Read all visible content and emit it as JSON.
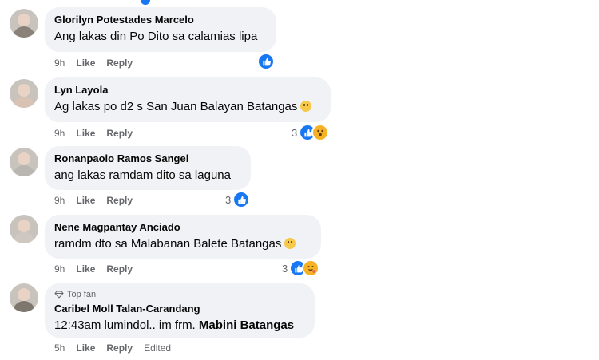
{
  "comments": [
    {
      "name": "Glorilyn Potestades Marcelo",
      "text": "Ang lakas din Po Dito sa calamias lipa",
      "time": "9h",
      "like": "Like",
      "reply": "Reply",
      "reaction_count": "",
      "reactions": [
        "like-icon"
      ]
    },
    {
      "name": "Lyn Layola",
      "text": "Ag lakas po d2 s San Juan Balayan Batangas",
      "time": "9h",
      "like": "Like",
      "reply": "Reply",
      "reaction_count": "3",
      "reactions": [
        "like-icon",
        "wow-icon"
      ]
    },
    {
      "name": "Ronanpaolo Ramos Sangel",
      "text": "ang lakas ramdam dito sa laguna",
      "time": "9h",
      "like": "Like",
      "reply": "Reply",
      "reaction_count": "3",
      "reactions": [
        "like-icon"
      ]
    },
    {
      "name": "Nene Magpantay Anciado",
      "text": "ramdm dto sa Malabanan Balete Batangas",
      "time": "9h",
      "like": "Like",
      "reply": "Reply",
      "reaction_count": "3",
      "reactions": [
        "like-icon",
        "care-icon"
      ]
    },
    {
      "badge": "Top fan",
      "name": "Caribel Moll Talan-Carandang",
      "text_plain": "12:43am lumindol.. im frm. ",
      "text_bold": "Mabini Batangas",
      "time": "5h",
      "like": "Like",
      "reply": "Reply",
      "edited": "Edited"
    }
  ]
}
